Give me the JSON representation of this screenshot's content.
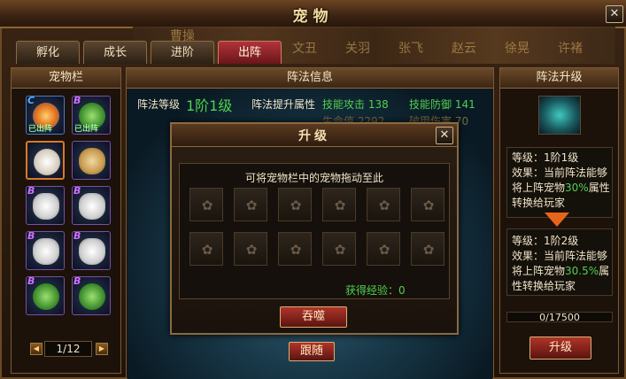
{
  "window": {
    "title": "宠物",
    "close": "✕"
  },
  "scene": {
    "names": [
      "曹操",
      "文丑",
      "关羽",
      "张飞",
      "赵云",
      "徐晃",
      "许褚"
    ]
  },
  "tabs": [
    {
      "label": "孵化"
    },
    {
      "label": "成长"
    },
    {
      "label": "进阶"
    },
    {
      "label": "出阵",
      "active": true
    }
  ],
  "pet_panel": {
    "title": "宠物栏",
    "pets": [
      {
        "grade": "C",
        "kind": "bird",
        "deployed": "已出阵"
      },
      {
        "grade": "B",
        "kind": "frog",
        "deployed": "已出阵"
      },
      {
        "grade": "",
        "kind": "egg",
        "selected": true
      },
      {
        "grade": "",
        "kind": "dog"
      },
      {
        "grade": "B",
        "kind": "helm"
      },
      {
        "grade": "B",
        "kind": "helm"
      },
      {
        "grade": "B",
        "kind": "helm"
      },
      {
        "grade": "B",
        "kind": "helm"
      },
      {
        "grade": "B",
        "kind": "frog"
      },
      {
        "grade": "B",
        "kind": "frog"
      }
    ],
    "pager": {
      "text": "1/12",
      "prev": "◀",
      "next": "▶"
    }
  },
  "formation_info": {
    "title": "阵法信息",
    "level_label": "阵法等级",
    "level_value": "1阶1级",
    "boost_label": "阵法提升属性",
    "skill_attack": "技能攻击 138",
    "skill_defense": "技能防御 141",
    "row2_left": "生命值 2292",
    "row2_right": "破甲伤害 70"
  },
  "upgrade_dialog": {
    "title": "升级",
    "close": "✕",
    "hint": "可将宠物栏中的宠物拖动至此",
    "slot_icon": "paw-icon",
    "slot_count": 12,
    "exp_label": "获得经验：0",
    "devour_button": "吞噬"
  },
  "follow_button": "跟随",
  "formation_upgrade": {
    "title": "阵法升级",
    "current": {
      "level": "等级：1阶1级",
      "effect": "效果：当前阵法能够",
      "line3_a": "将上阵宠物",
      "percent": "30%",
      "line3_b": "属性",
      "line4": "转换给玩家"
    },
    "next": {
      "level": "等级：1阶2级",
      "effect": "效果：当前阵法能够",
      "line3_a": "将上阵宠物",
      "percent": "30.5%",
      "line3_b": "属",
      "line4": "性转换给玩家"
    },
    "progress": "0/17500",
    "progress_fraction": 0,
    "upgrade_button": "升级"
  },
  "colors": {
    "accent_red": "#b0342a",
    "green": "#50d050",
    "arrow": "#e8641a"
  }
}
